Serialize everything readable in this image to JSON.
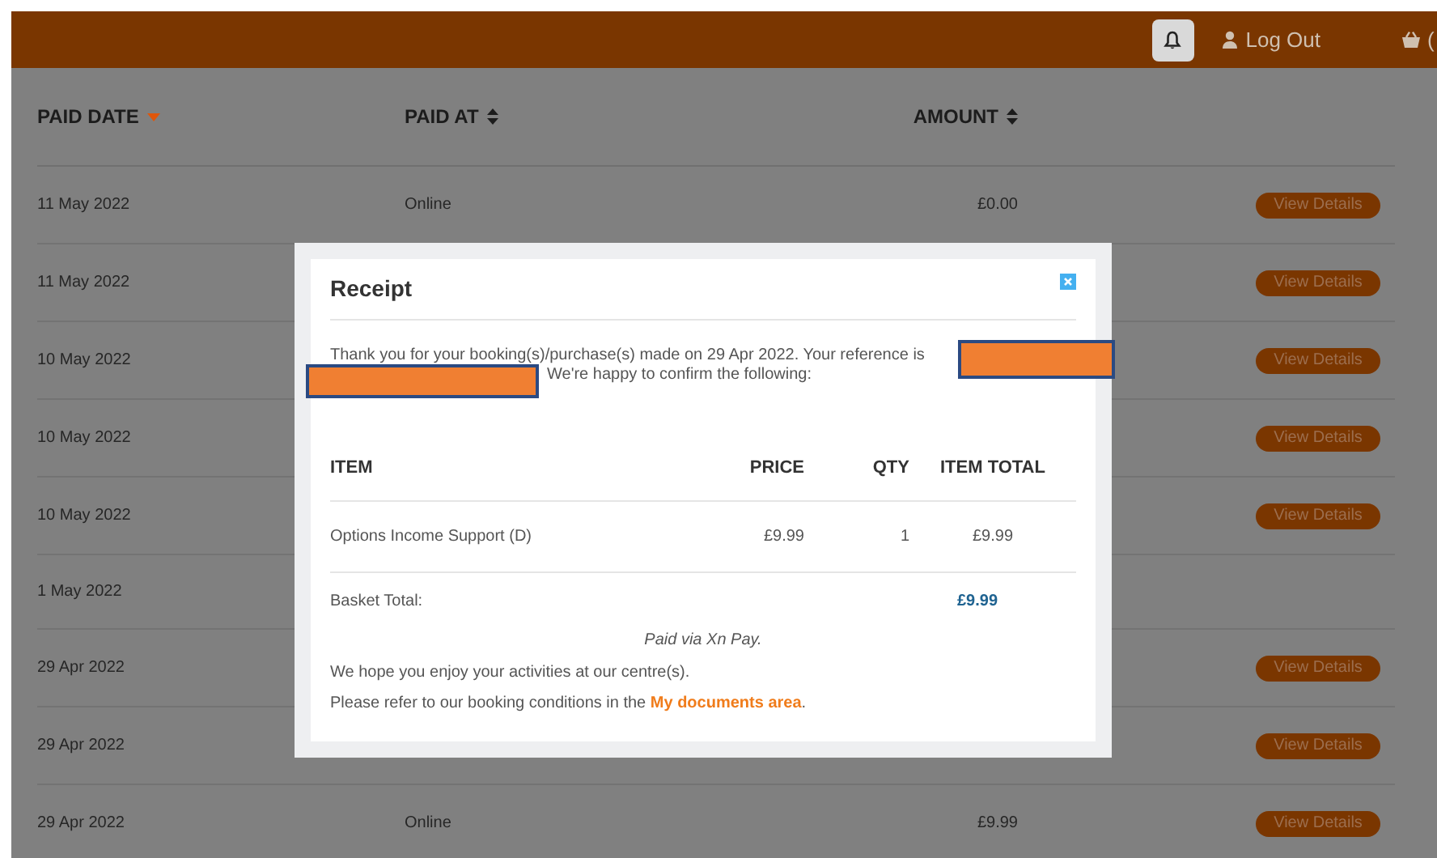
{
  "header": {
    "logout": "Log Out",
    "basket": "("
  },
  "table": {
    "columns": [
      {
        "label": "PAID DATE",
        "sorted": true
      },
      {
        "label": "PAID AT",
        "sorted": false
      },
      {
        "label": "AMOUNT",
        "sorted": false
      }
    ],
    "rows": [
      {
        "paid_date": "11 May 2022",
        "paid_at": "Online",
        "amount": "£0.00",
        "action": "View Details"
      },
      {
        "paid_date": "11 May 2022",
        "action": "View Details"
      },
      {
        "paid_date": "10 May 2022",
        "action": "View Details"
      },
      {
        "paid_date": "10 May 2022",
        "action": "View Details"
      },
      {
        "paid_date": "10 May 2022",
        "action": "View Details"
      },
      {
        "paid_date": "1 May 2022"
      },
      {
        "paid_date": "29 Apr 2022",
        "action": "View Details"
      },
      {
        "paid_date": "29 Apr 2022",
        "action": "View Details"
      },
      {
        "paid_date": "29 Apr 2022",
        "paid_at": "Online",
        "amount": "£9.99",
        "action": "View Details"
      }
    ]
  },
  "modal": {
    "title": "Receipt",
    "intro": "Thank you for your booking(s)/purchase(s) made on 29 Apr 2022. Your reference is",
    "intro_continued": "We're happy to confirm the following:",
    "columns": [
      "ITEM",
      "PRICE",
      "QTY",
      "ITEM TOTAL"
    ],
    "items": [
      {
        "item": "Options Income Support (D)",
        "price": "£9.99",
        "qty": "1",
        "total": "£9.99"
      }
    ],
    "basket_total_label": "Basket Total:",
    "basket_total": "£9.99",
    "paid_via": "Paid via Xn Pay.",
    "closing": "We hope you enjoy your activities at our centre(s).",
    "conditions": {
      "before": "Please refer to our booking conditions in the ",
      "link": "My documents area",
      "after": "."
    }
  }
}
